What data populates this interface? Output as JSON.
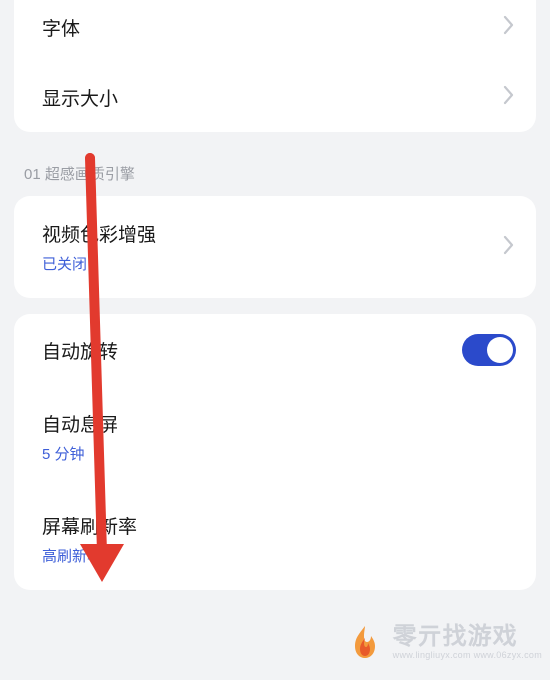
{
  "group1": {
    "font": {
      "label": "字体"
    },
    "displaySize": {
      "label": "显示大小"
    }
  },
  "sectionTitle": "01 超感画质引擎",
  "group2": {
    "videoColor": {
      "label": "视频色彩增强",
      "sublabel": "已关闭"
    }
  },
  "group3": {
    "autoRotate": {
      "label": "自动旋转",
      "toggle": true
    },
    "autoSleep": {
      "label": "自动息屏",
      "sublabel": "5 分钟"
    },
    "refreshRate": {
      "label": "屏幕刷新率",
      "sublabel": "高刷新率"
    }
  },
  "watermark": {
    "main": "零亓找游戏",
    "urls": "www.lingliuyx.com   www.06zyx.com"
  }
}
